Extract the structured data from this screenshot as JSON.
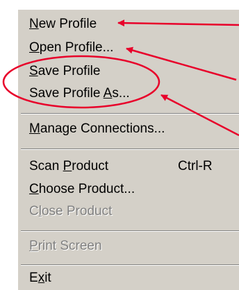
{
  "menu": {
    "items": [
      {
        "pre": "",
        "u": "N",
        "post": "ew Profile"
      },
      {
        "pre": "",
        "u": "O",
        "post": "pen Profile..."
      },
      {
        "pre": "",
        "u": "S",
        "post": "ave Profile"
      },
      {
        "pre": "Save Profile ",
        "u": "A",
        "post": "s..."
      },
      {
        "pre": "",
        "u": "M",
        "post": "anage Connections..."
      },
      {
        "pre": "Scan ",
        "u": "P",
        "post": "roduct",
        "shortcut": "Ctrl-R"
      },
      {
        "pre": "",
        "u": "C",
        "post": "hoose Product..."
      },
      {
        "pre": "C",
        "u": "l",
        "post": "ose Product"
      },
      {
        "pre": "",
        "u": "P",
        "post": "rint Screen"
      },
      {
        "pre": "E",
        "u": "x",
        "post": "it"
      }
    ]
  },
  "colors": {
    "menu_background": "#d4d0c8",
    "disabled_text": "#808080",
    "annotation": "#e8002a"
  }
}
